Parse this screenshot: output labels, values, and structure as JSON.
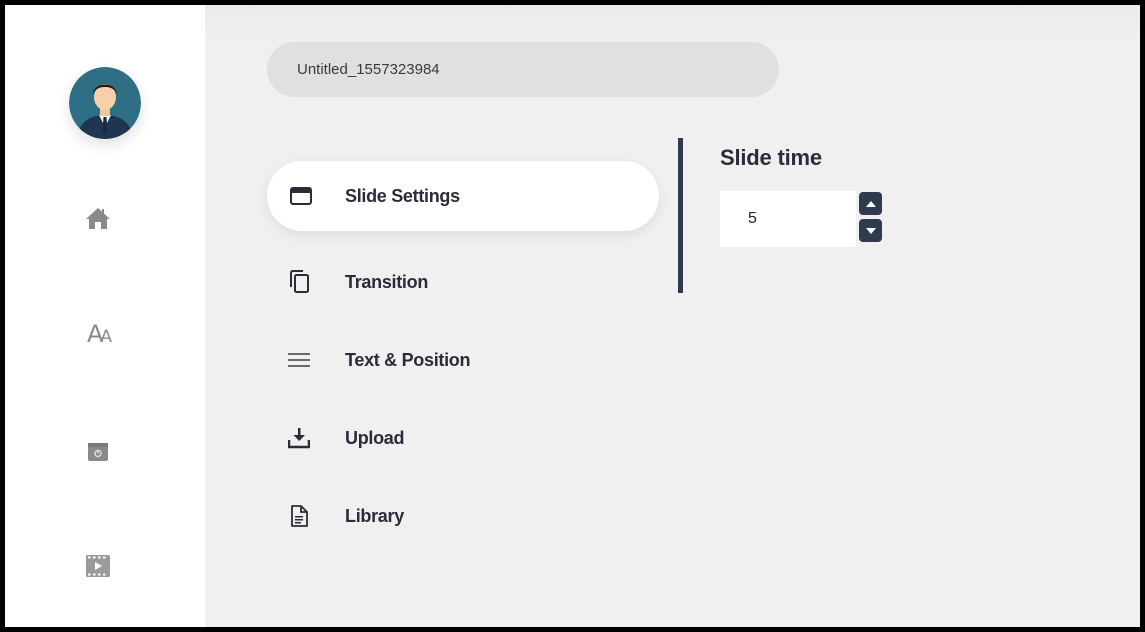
{
  "project": {
    "title": "Untitled_1557323984"
  },
  "sidebar": {
    "icons": [
      "user-avatar",
      "home-icon",
      "text-icon",
      "archive-icon",
      "video-icon"
    ],
    "text_glyph": "A",
    "text_glyph_small": "A"
  },
  "menu": {
    "active_index": 0,
    "items": [
      {
        "label": "Slide Settings",
        "icon": "slide-icon"
      },
      {
        "label": "Transition",
        "icon": "copy-icon"
      },
      {
        "label": "Text & Position",
        "icon": "lines-icon"
      },
      {
        "label": "Upload",
        "icon": "download-tray-icon"
      },
      {
        "label": "Library",
        "icon": "document-icon"
      }
    ]
  },
  "slide_settings": {
    "slide_time_label": "Slide time",
    "slide_time_value": "5"
  },
  "colors": {
    "accent_dark": "#2f3a4f",
    "sidebar_icon": "#8a8a8a",
    "panel_bg": "#f0f0f0",
    "pill_bg": "#e0e0e0"
  }
}
